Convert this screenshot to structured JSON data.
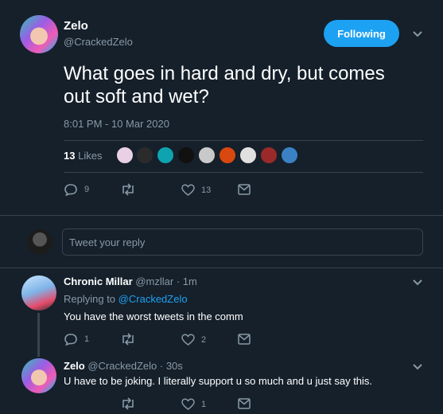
{
  "tweet": {
    "author_name": "Zelo",
    "author_handle": "@CrackedZelo",
    "follow_label": "Following",
    "text_line1": "What goes in hard and dry, but comes",
    "text_line2": "out soft and wet?",
    "timestamp": "8:01 PM - 10 Mar 2020",
    "likes_count": "13",
    "likes_label": "Likes",
    "reply_count": "9",
    "like_count": "13"
  },
  "compose": {
    "placeholder": "Tweet your reply"
  },
  "replies": [
    {
      "name": "Chronic Millar",
      "handle": "@mzllar",
      "time": "· 1m",
      "replying_to_label": "Replying to",
      "replying_to_handle": "@CrackedZelo",
      "text": "You have the worst tweets in the comm",
      "reply_count": "1",
      "like_count": "2"
    },
    {
      "name": "Zelo",
      "handle": "@CrackedZelo",
      "time": "· 30s",
      "text": "U have to be joking. I literally support u so much and u just say this.",
      "like_count": "1"
    }
  ],
  "colors": {
    "background": "#15202b",
    "accent": "#1da1f2",
    "muted": "#8899a6",
    "divider": "#38444d"
  }
}
